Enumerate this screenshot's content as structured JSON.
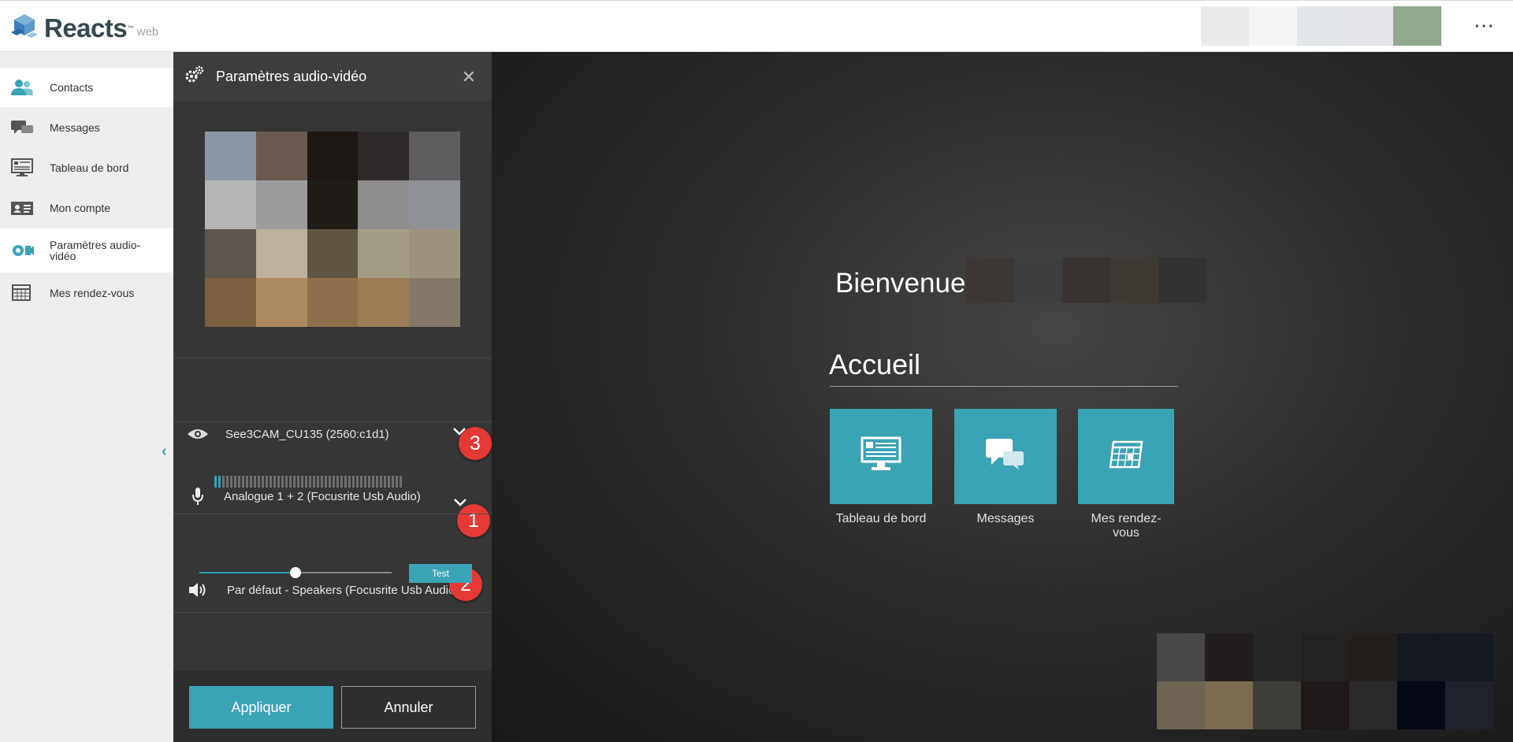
{
  "header": {
    "app_name": "Reacts",
    "trademark": "™",
    "app_suffix": "web",
    "menu_glyph": "⋯"
  },
  "sidebar": {
    "items": [
      {
        "label": "Contacts",
        "icon": "contacts-icon"
      },
      {
        "label": "Messages",
        "icon": "messages-icon"
      },
      {
        "label": "Tableau de bord",
        "icon": "dashboard-icon"
      },
      {
        "label": "Mon compte",
        "icon": "account-card-icon"
      },
      {
        "label": "Paramètres audio-vidéo",
        "icon": "audio-video-settings-icon"
      },
      {
        "label": "Mes rendez-vous",
        "icon": "calendar-icon"
      }
    ],
    "active_index": 4,
    "collapse_glyph": "‹"
  },
  "settings_panel": {
    "title": "Paramètres audio-vidéo",
    "close_glyph": "✕",
    "camera": {
      "value": "See3CAM_CU135 (2560:c1d1)",
      "badge": "3"
    },
    "microphone": {
      "value": "Analogue 1 + 2 (Focusrite Usb Audio)",
      "badge": "1",
      "level": 0.05
    },
    "speaker": {
      "value": "Par défaut - Speakers (Focusrite Usb Audio)",
      "badge": "2",
      "volume": 0.5,
      "test_label": "Test"
    },
    "apply_label": "Appliquer",
    "cancel_label": "Annuler"
  },
  "main": {
    "welcome": "Bienvenue",
    "section_title": "Accueil",
    "tiles": [
      {
        "label": "Tableau de bord",
        "icon": "dashboard-monitor-icon"
      },
      {
        "label": "Messages",
        "icon": "chat-bubbles-icon"
      },
      {
        "label": "Mes rendez-vous",
        "icon": "calendar-grid-icon"
      }
    ]
  },
  "colors": {
    "accent": "#3aa3b6",
    "badge": "#e53935",
    "panel_bg": "#363636",
    "sidebar_bg": "#eeeeee"
  }
}
